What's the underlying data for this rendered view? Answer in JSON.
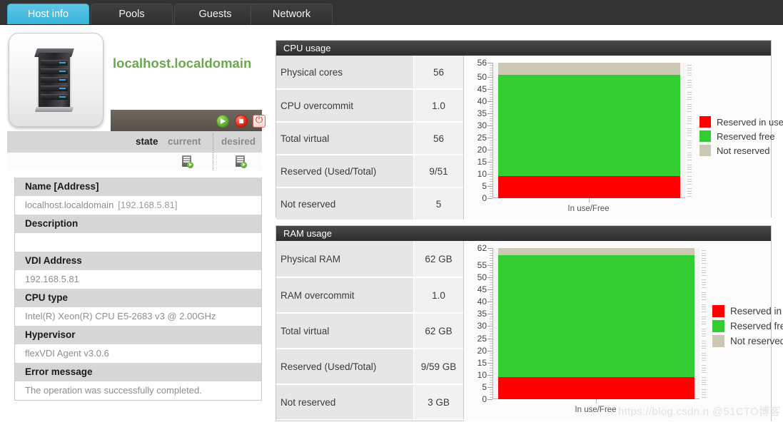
{
  "tabs": [
    {
      "label": "Host info",
      "active": true
    },
    {
      "label": "Pools",
      "active": false
    },
    {
      "label": "Guests",
      "active": false
    },
    {
      "label": "Network",
      "active": false
    }
  ],
  "host": {
    "title": "localhost.localdomain",
    "actions": [
      {
        "name": "start-button",
        "icon": "play-icon"
      },
      {
        "name": "stop-button",
        "icon": "stop-icon"
      },
      {
        "name": "power-button",
        "icon": "power-icon"
      }
    ],
    "state_header": {
      "state": "state",
      "current": "current",
      "desired": "desired"
    },
    "info": [
      {
        "label": "Name [Address]",
        "value": "localhost.localdomain",
        "address": "[192.168.5.81]"
      },
      {
        "label": "Description",
        "value": ""
      },
      {
        "label": "VDI Address",
        "value": "192.168.5.81"
      },
      {
        "label": "CPU type",
        "value": "Intel(R) Xeon(R) CPU E5-2683 v3 @ 2.00GHz"
      },
      {
        "label": "Hypervisor",
        "value": "flexVDI Agent v3.0.6"
      },
      {
        "label": "Error message",
        "value": "The operation was successfully completed."
      }
    ]
  },
  "cpu_panel": {
    "title": "CPU usage",
    "metrics": [
      {
        "key": "Physical cores",
        "value": "56"
      },
      {
        "key": "CPU overcommit",
        "value": "1.0"
      },
      {
        "key": "Total virtual",
        "value": "56"
      },
      {
        "key": "Reserved (Used/Total)",
        "value": "9/51"
      },
      {
        "key": "Not reserved",
        "value": "5"
      }
    ]
  },
  "ram_panel": {
    "title": "RAM usage",
    "metrics": [
      {
        "key": "Physical RAM",
        "value": "62 GB"
      },
      {
        "key": "RAM overcommit",
        "value": "1.0"
      },
      {
        "key": "Total virtual",
        "value": "62 GB"
      },
      {
        "key": "Reserved (Used/Total)",
        "value": "9/59 GB"
      },
      {
        "key": "Not reserved",
        "value": "3 GB"
      }
    ]
  },
  "colors": {
    "reserved_in_use": "#ff0000",
    "reserved_free": "#33cc33",
    "not_reserved": "#cdc8b6",
    "accent": "#4fbbdd",
    "host_title": "#6aa84f"
  },
  "chart_data": [
    {
      "type": "bar",
      "id": "cpu-chart",
      "title": "CPU usage",
      "stacked": true,
      "categories": [
        "In use/Free"
      ],
      "xlabel": "In use/Free",
      "ylabel": "",
      "ylim": [
        0,
        56
      ],
      "yticks": [
        0,
        5,
        10,
        15,
        20,
        25,
        30,
        35,
        40,
        45,
        50,
        56
      ],
      "grid": false,
      "legend_position": "right",
      "series": [
        {
          "name": "Reserved in use",
          "color": "#ff0000",
          "values": [
            9
          ]
        },
        {
          "name": "Reserved free",
          "color": "#33cc33",
          "values": [
            42
          ]
        },
        {
          "name": "Not reserved",
          "color": "#cdc8b6",
          "values": [
            5
          ]
        }
      ],
      "cumulative_tops": [
        9,
        51,
        56
      ]
    },
    {
      "type": "bar",
      "id": "ram-chart",
      "title": "RAM usage",
      "stacked": true,
      "categories": [
        "In use/Free"
      ],
      "xlabel": "In use/Free",
      "ylabel": "",
      "ylim": [
        0,
        62
      ],
      "yticks": [
        0,
        5,
        10,
        15,
        20,
        25,
        30,
        35,
        40,
        45,
        50,
        55,
        62
      ],
      "grid": false,
      "legend_position": "right",
      "series": [
        {
          "name": "Reserved in use",
          "color": "#ff0000",
          "values": [
            9
          ]
        },
        {
          "name": "Reserved free",
          "color": "#33cc33",
          "values": [
            50
          ]
        },
        {
          "name": "Not reserved",
          "color": "#cdc8b6",
          "values": [
            3
          ]
        }
      ],
      "cumulative_tops": [
        9,
        59,
        62
      ]
    }
  ],
  "legend_items": [
    "Reserved in use",
    "Reserved free",
    "Not reserved"
  ],
  "watermark": "https://blog.csdn.n @51CTO博客"
}
